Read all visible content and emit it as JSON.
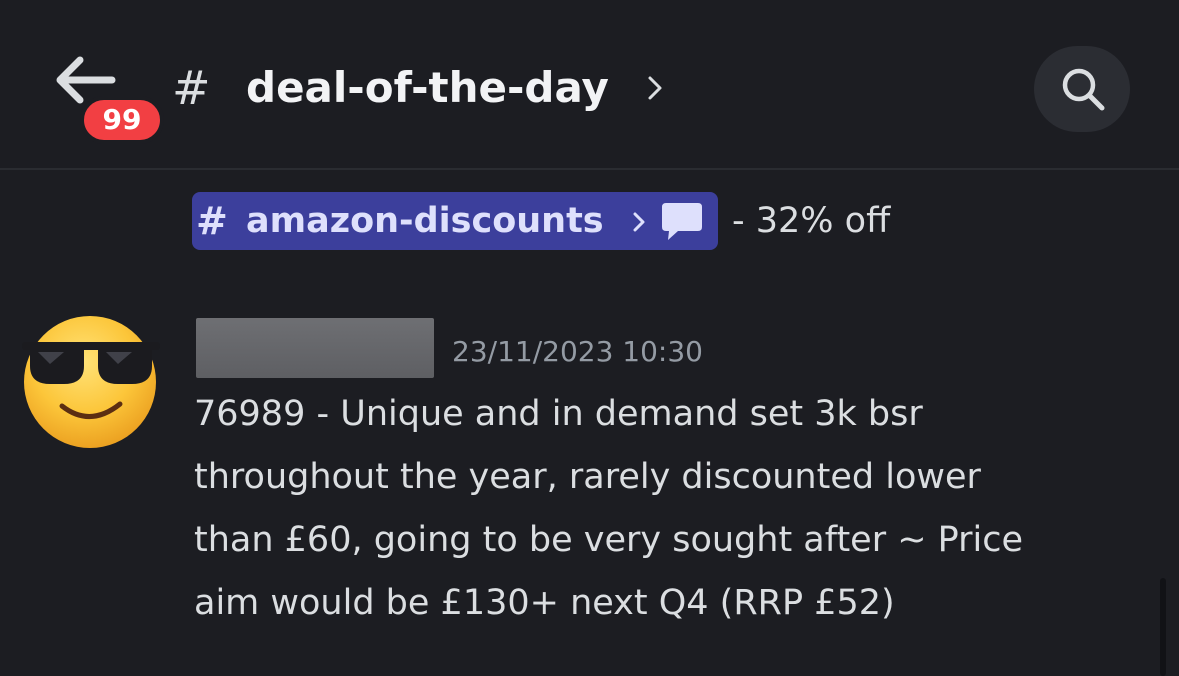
{
  "header": {
    "unread_count": "99",
    "channel_hash": "#",
    "channel_name": "deal-of-the-day",
    "icons": {
      "back": "arrow-left-icon",
      "chevron": "chevron-right-icon",
      "search": "search-icon"
    }
  },
  "mention": {
    "hash": "#",
    "channel_name": "amazon-discounts",
    "suffix": "- 32% off",
    "icons": {
      "chevron": "chevron-right-icon",
      "thread": "thread-bubble-icon"
    }
  },
  "message": {
    "timestamp": "23/11/2023 10:30",
    "lines": [
      "76989 - Unique and in demand set 3k bsr",
      "throughout the year, rarely discounted lower",
      "than £60, going to be very sought after ~ Price",
      "aim would be £130+ next Q4 (RRP £52)"
    ],
    "avatar": "sunglasses-emoji-avatar"
  },
  "colors": {
    "background": "#1c1d22",
    "badge": "#f23f43",
    "mention_bg": "#3c3f9c",
    "mention_text": "#dee0fc",
    "muted_text": "#949ba4",
    "body_text": "#dbdee1"
  }
}
